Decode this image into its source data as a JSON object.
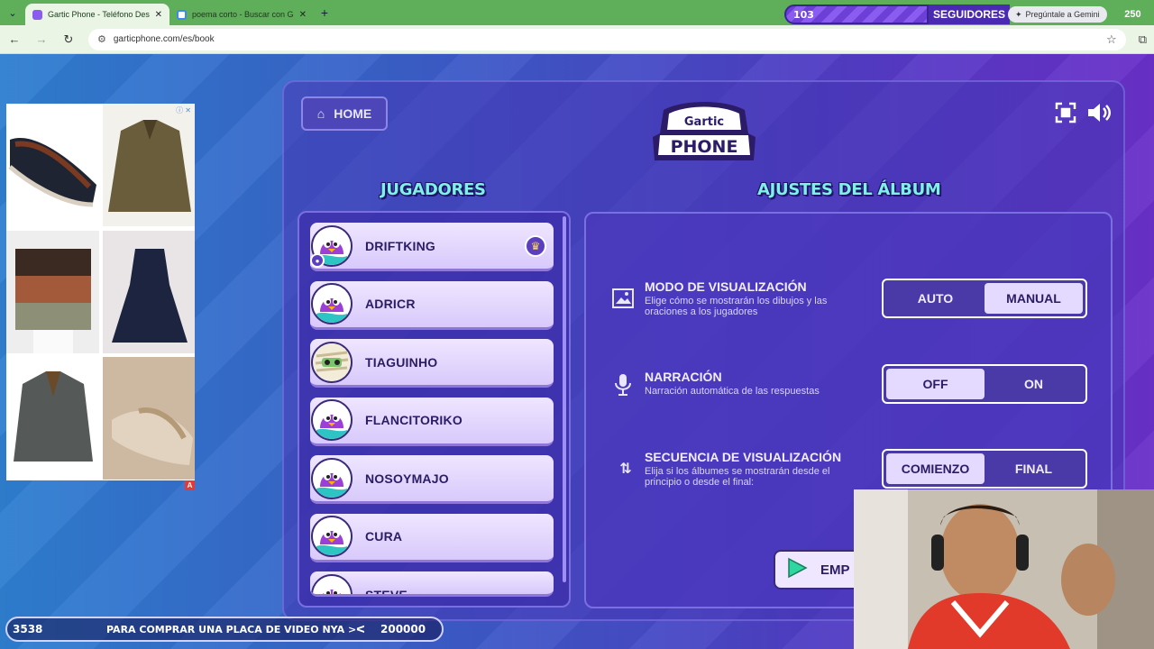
{
  "browser": {
    "tabs": [
      {
        "title": "Gartic Phone - Teléfono Descon",
        "active": true
      },
      {
        "title": "poema corto - Buscar con Goog",
        "active": false
      }
    ],
    "url": "garticphone.com/es/book"
  },
  "stream_overlay": {
    "follower_count": "103",
    "followers_label": "SEGUIDORES",
    "gemini_label": "Pregúntale a Gemini",
    "follower_goal": "250",
    "goal_current": "3538",
    "goal_text": "PARA COMPRAR UNA PLACA DE VIDEO NYA >ᐸ",
    "goal_target": "200000"
  },
  "header": {
    "home_label": "HOME",
    "logo_top": "Gartic",
    "logo_bottom": "PHONE"
  },
  "players_section": {
    "title": "JUGADORES",
    "players": [
      {
        "name": "DRIFTKING",
        "host": true,
        "avatar": "purple-bird"
      },
      {
        "name": "ADRICR",
        "host": false,
        "avatar": "purple-bird"
      },
      {
        "name": "TIAGUINHO",
        "host": false,
        "avatar": "mummy"
      },
      {
        "name": "FLANCITORIKO",
        "host": false,
        "avatar": "purple-bird"
      },
      {
        "name": "NOSOYMAJO",
        "host": false,
        "avatar": "purple-bird"
      },
      {
        "name": "CURA",
        "host": false,
        "avatar": "purple-bird"
      },
      {
        "name": "STEVE",
        "host": false,
        "avatar": "purple-bird"
      }
    ]
  },
  "settings_section": {
    "title": "AJUSTES DEL ÁLBUM",
    "rows": [
      {
        "title": "MODO DE VISUALIZACIÓN",
        "desc": "Elige cómo se mostrarán los dibujos y las oraciones a los jugadores",
        "options": [
          "AUTO",
          "MANUAL"
        ],
        "selected": 1,
        "icon": "image-icon"
      },
      {
        "title": "NARRACIÓN",
        "desc": "Narración automática de las respuestas",
        "options": [
          "OFF",
          "ON"
        ],
        "selected": 0,
        "icon": "microphone-icon"
      },
      {
        "title": "SECUENCIA DE VISUALIZACIÓN",
        "desc": "Elija si los álbumes se mostrarán desde el principio o desde el final:",
        "options": [
          "COMIENZO",
          "FINAL"
        ],
        "selected": 0,
        "icon": "up-down-arrows-icon"
      }
    ],
    "start_label": "EMP"
  },
  "colors": {
    "accent_cyan": "#7ff0e6",
    "panel": "#4a3aa8",
    "card": "#efe6ff"
  }
}
